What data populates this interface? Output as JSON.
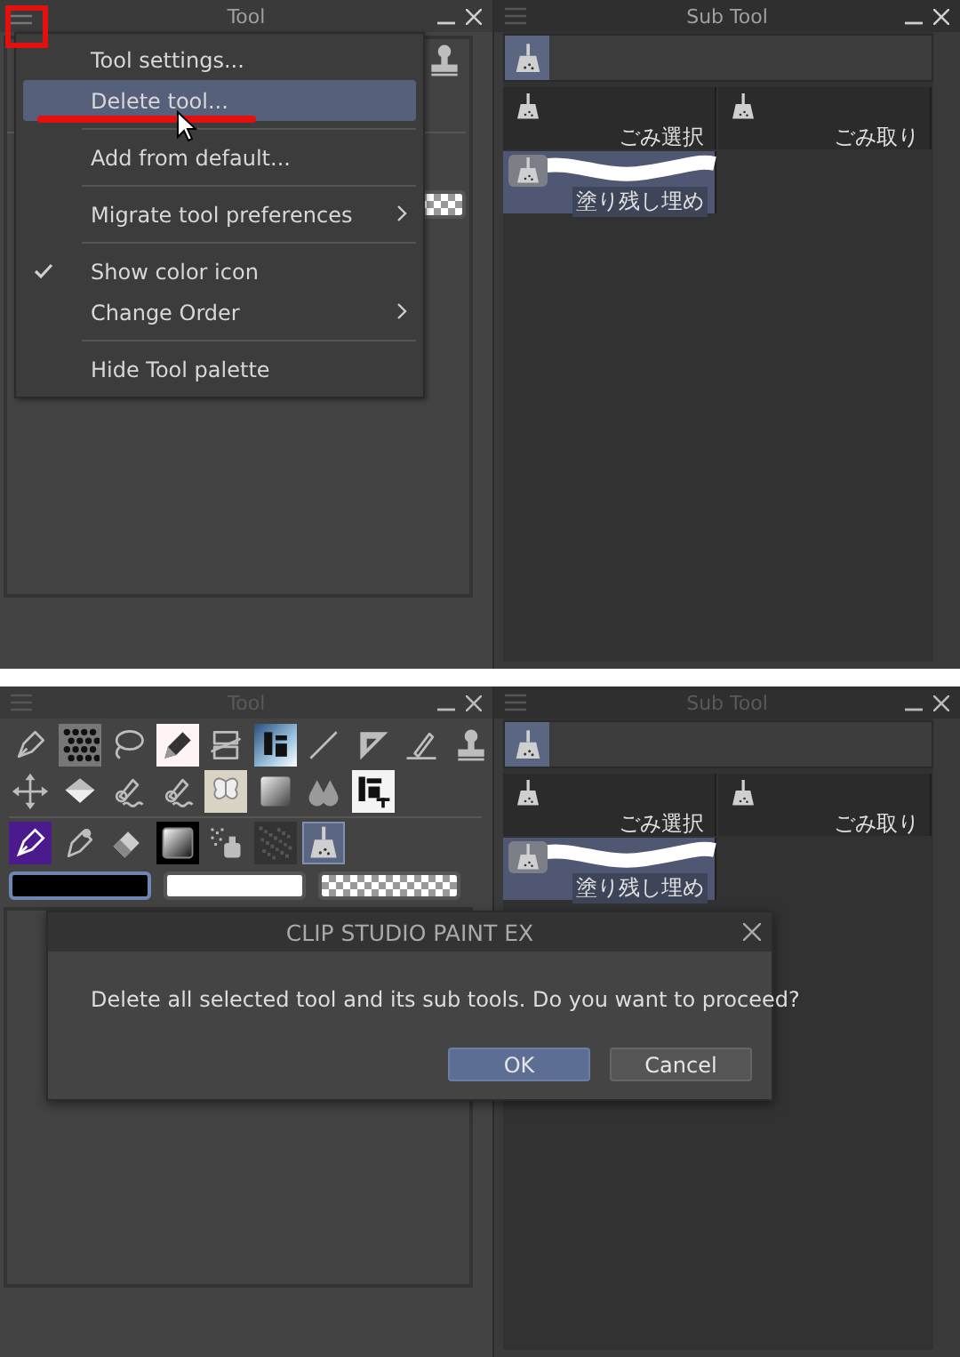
{
  "top_screen": {
    "tool_palette": {
      "title": "Tool",
      "active": true,
      "menu_button_highlighted": true,
      "visible_tools": [
        {
          "kind": "stamp",
          "selected": false
        }
      ],
      "visible_swatches": [
        {
          "kind": "transparent",
          "selected": false
        }
      ],
      "menu": {
        "groups": [
          [
            {
              "label": "Tool settings...",
              "selected": false,
              "checked": false,
              "submenu": false,
              "underlined": false,
              "pointer": false
            },
            {
              "label": "Delete tool...",
              "selected": true,
              "checked": false,
              "submenu": false,
              "underlined": true,
              "pointer": true
            }
          ],
          [
            {
              "label": "Add from default...",
              "selected": false,
              "checked": false,
              "submenu": false,
              "underlined": false,
              "pointer": false
            }
          ],
          [
            {
              "label": "Migrate tool preferences",
              "selected": false,
              "checked": false,
              "submenu": true,
              "underlined": false,
              "pointer": false
            }
          ],
          [
            {
              "label": "Show color icon",
              "selected": false,
              "checked": true,
              "submenu": false,
              "underlined": false,
              "pointer": false
            },
            {
              "label": "Change Order",
              "selected": false,
              "checked": false,
              "submenu": true,
              "underlined": false,
              "pointer": false
            }
          ],
          [
            {
              "label": "Hide Tool palette",
              "selected": false,
              "checked": false,
              "submenu": false,
              "underlined": false,
              "pointer": false
            }
          ]
        ]
      }
    },
    "sub_tool_palette": {
      "title": "Sub Tool",
      "active": true,
      "groups": [
        {
          "kind": "dustpan",
          "selected": true
        }
      ],
      "sub_tools": [
        {
          "label": "ごみ選択",
          "kind": "dustpan",
          "selected": false
        },
        {
          "label": "ごみ取り",
          "kind": "dustpan",
          "selected": false
        },
        {
          "label": "塗り残し埋め",
          "kind": "dustpan",
          "selected": true
        }
      ]
    }
  },
  "bottom_screen": {
    "tool_palette": {
      "title": "Tool",
      "active": false,
      "tool_sections": [
        {
          "rows": [
            [
              {
                "kind": "pen",
                "selected": false
              },
              {
                "kind": "dither",
                "selected": false
              },
              {
                "kind": "lasso",
                "selected": false
              },
              {
                "kind": "marker",
                "selected": false
              },
              {
                "kind": "frame",
                "selected": false
              },
              {
                "kind": "image",
                "selected": false
              },
              {
                "kind": "line",
                "selected": false
              },
              {
                "kind": "ruler",
                "selected": false
              },
              {
                "kind": "line_pen",
                "selected": false
              },
              {
                "kind": "stamp",
                "selected": false
              }
            ],
            [
              {
                "kind": "move",
                "selected": false
              },
              {
                "kind": "fill",
                "selected": false
              },
              {
                "kind": "wave_brush",
                "selected": false
              },
              {
                "kind": "wave_brush",
                "selected": false
              },
              {
                "kind": "butterfly",
                "selected": false
              },
              {
                "kind": "gradient",
                "selected": false
              },
              {
                "kind": "drops",
                "selected": false
              },
              {
                "kind": "text",
                "selected": false
              }
            ]
          ]
        },
        {
          "rows": [
            [
              {
                "kind": "color_pen",
                "selected": false
              },
              {
                "kind": "brush",
                "selected": false
              },
              {
                "kind": "eraser",
                "selected": false
              },
              {
                "kind": "gradient_dark",
                "selected": false
              },
              {
                "kind": "spray",
                "selected": false
              },
              {
                "kind": "texture",
                "selected": false
              },
              {
                "kind": "dustpan",
                "selected": true
              }
            ]
          ]
        }
      ],
      "color_swatches": [
        {
          "kind": "main",
          "color": "#000000",
          "selected": true
        },
        {
          "kind": "sub",
          "color": "#ffffff",
          "selected": false
        },
        {
          "kind": "transparent",
          "selected": false
        }
      ],
      "dialog": {
        "title": "CLIP STUDIO PAINT EX",
        "message": "Delete all selected tool and its sub tools. Do you want to proceed?",
        "buttons": [
          {
            "label": "OK",
            "selected": true
          },
          {
            "label": "Cancel",
            "selected": false
          }
        ]
      }
    },
    "sub_tool_palette": {
      "title": "Sub Tool",
      "active": false,
      "groups": [
        {
          "kind": "dustpan",
          "selected": true
        }
      ],
      "sub_tools": [
        {
          "label": "ごみ選択",
          "kind": "dustpan",
          "selected": false
        },
        {
          "label": "ごみ取り",
          "kind": "dustpan",
          "selected": false
        },
        {
          "label": "塗り残し埋め",
          "kind": "dustpan",
          "selected": true
        }
      ]
    }
  }
}
